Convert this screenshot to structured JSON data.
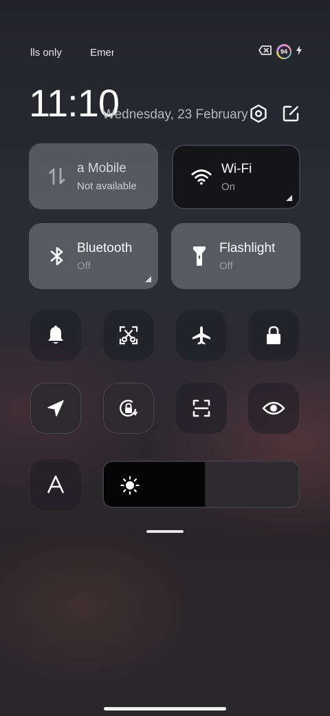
{
  "status_bar": {
    "left_text_1": "lls only",
    "left_text_2": "Emer",
    "battery_level": "94",
    "icons": [
      "sim-off-icon",
      "battery-ring-icon",
      "charging-bolt-icon"
    ]
  },
  "header": {
    "time": "11:10",
    "date": "Wednesday, 23 February",
    "icons": [
      "settings-hexagon-icon",
      "edit-icon"
    ]
  },
  "tiles": {
    "mobile": {
      "title": "a      Mobile",
      "subtitle": "Not available",
      "icon": "mobile-data-icon"
    },
    "wifi": {
      "title": "Wi-Fi",
      "subtitle": "On",
      "icon": "wifi-icon"
    },
    "bluetooth": {
      "title": "Bluetooth",
      "subtitle": "Off",
      "icon": "bluetooth-icon"
    },
    "flashlight": {
      "title": "Flashlight",
      "subtitle": "Off",
      "icon": "flashlight-icon"
    }
  },
  "toggles": [
    {
      "icon": "bell-icon"
    },
    {
      "icon": "screenshot-scissors-icon"
    },
    {
      "icon": "airplane-icon"
    },
    {
      "icon": "lock-icon"
    },
    {
      "icon": "location-icon"
    },
    {
      "icon": "rotation-lock-icon"
    },
    {
      "icon": "scan-icon"
    },
    {
      "icon": "eye-icon"
    },
    {
      "icon": "font-a-icon"
    }
  ],
  "brightness": {
    "level": 0.52,
    "icon": "sun-icon"
  },
  "colors": {
    "tile_light": "#aaacb4",
    "tile_dark": "#141418",
    "accent_white": "#ffffff"
  }
}
